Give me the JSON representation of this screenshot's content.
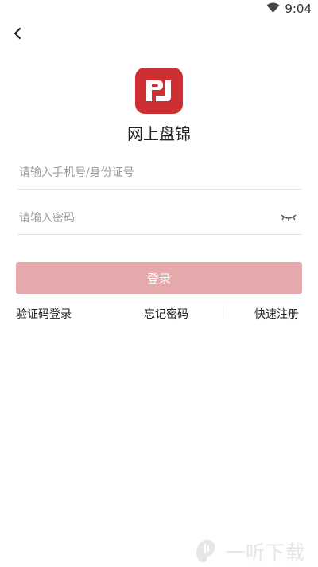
{
  "status_bar": {
    "time": "9:04",
    "wifi": "wifi-icon"
  },
  "header": {
    "back": "back-arrow-icon"
  },
  "app": {
    "logo_text": "PJ",
    "name": "网上盘锦",
    "brand_color": "#cd2f33"
  },
  "form": {
    "account": {
      "placeholder": "请输入手机号/身份证号",
      "value": ""
    },
    "password": {
      "placeholder": "请输入密码",
      "value": ""
    },
    "password_toggle": "eye-closed-icon",
    "login_label": "登录",
    "login_button_color": "#e5a9ab"
  },
  "links": {
    "sms_login": "验证码登录",
    "forgot_password": "忘记密码",
    "quick_register": "快速注册"
  },
  "watermark": {
    "text": "一听下载"
  }
}
